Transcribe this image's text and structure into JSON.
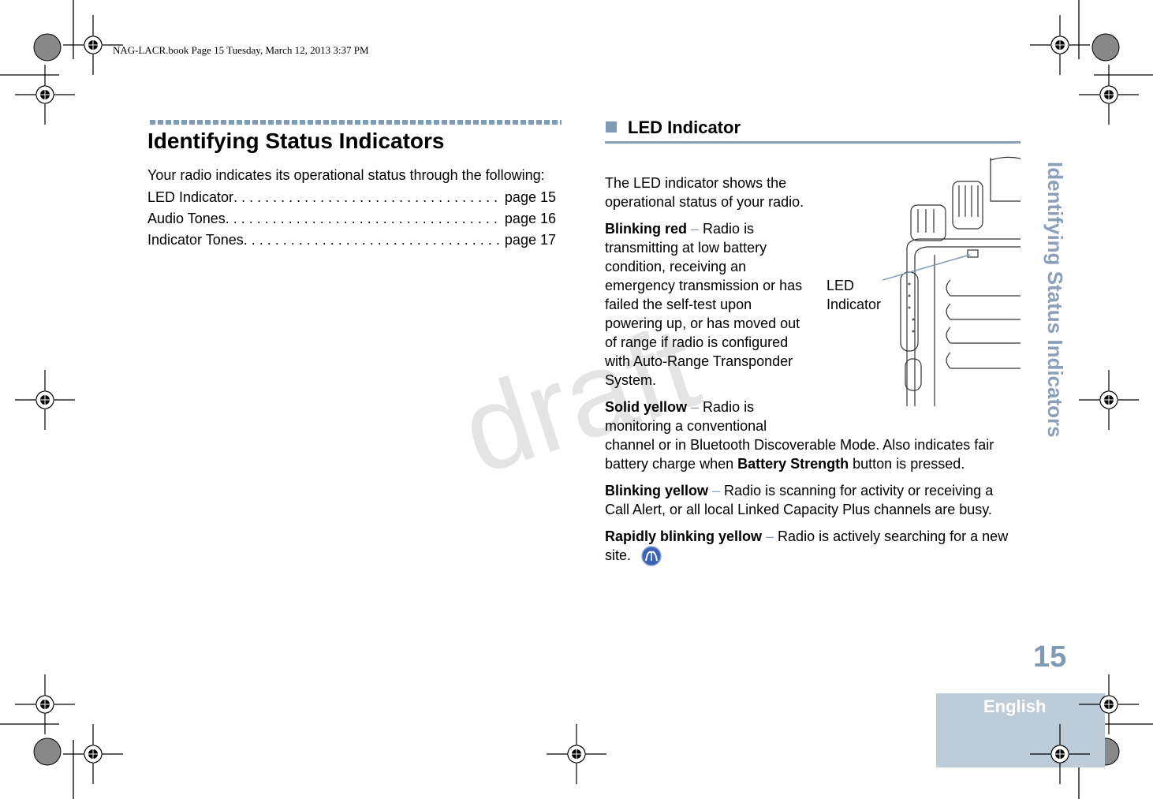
{
  "header": {
    "book_info": "NAG-LACR.book  Page 15  Tuesday, March 12, 2013  3:37 PM"
  },
  "left": {
    "title": "Identifying Status Indicators",
    "intro": "Your radio indicates its operational status through the following:",
    "toc": [
      {
        "label": "LED Indicator",
        "page": "page 15"
      },
      {
        "label": "Audio Tones",
        "page": "page 16"
      },
      {
        "label": "Indicator Tones ",
        "page": "page 17"
      }
    ]
  },
  "right": {
    "heading": "LED Indicator",
    "intro": "The LED indicator shows the operational status of your radio.",
    "figure_label_1": "LED",
    "figure_label_2": "Indicator",
    "items": [
      {
        "term": "Blinking red",
        "sep": " – ",
        "desc": "Radio is transmitting at low battery condition, receiving an emergency transmission or has failed the self-test upon powering up, or has moved out of range if radio is configured with Auto-Range Transponder System."
      },
      {
        "term": "Solid yellow",
        "sep": " –  ",
        "desc_1": "Radio is monitoring a conventional channel or in Bluetooth Discoverable Mode. Also indicates fair battery charge when ",
        "desc_bold": "Battery Strength",
        "desc_2": " button is pressed."
      },
      {
        "term": "Blinking yellow",
        "sep": " – ",
        "desc": "Radio is scanning for activity or receiving a Call Alert, or all local Linked Capacity Plus channels are busy."
      },
      {
        "term": "Rapidly blinking yellow",
        "sep": " – ",
        "desc": "Radio is actively searching for a new site."
      }
    ],
    "feature_icon": "globe-signal-icon"
  },
  "side_tab": "Identifying Status Indicators",
  "page_number": "15",
  "language": "English",
  "watermark": "draft",
  "colors": {
    "accent": "#7f9ab5",
    "tab_bg": "#bdccd9"
  }
}
